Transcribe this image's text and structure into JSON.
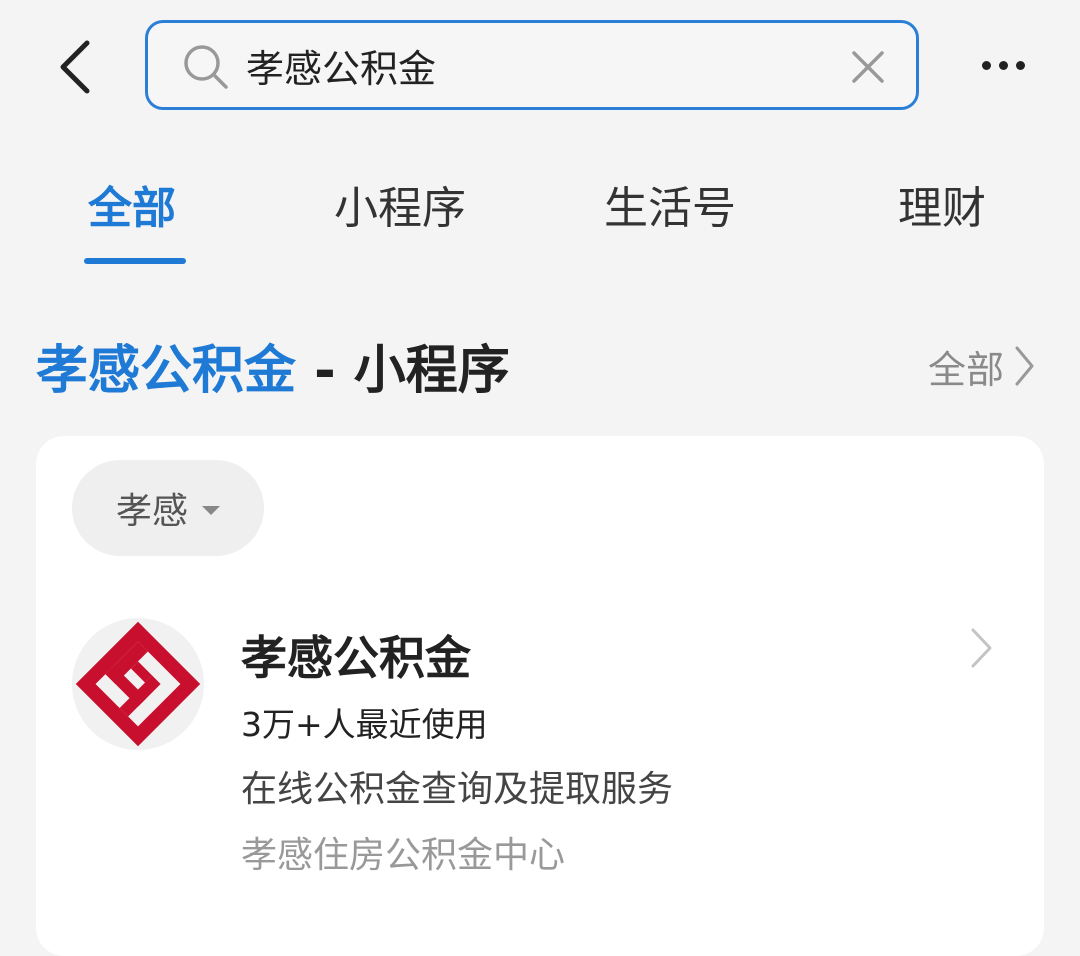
{
  "search": {
    "value": "孝感公积金"
  },
  "tabs": [
    {
      "label": "全部",
      "active": true
    },
    {
      "label": "小程序",
      "active": false
    },
    {
      "label": "生活号",
      "active": false
    },
    {
      "label": "理财",
      "active": false
    }
  ],
  "section": {
    "title_highlight": "孝感公积金",
    "title_rest": " - 小程序",
    "more_label": "全部"
  },
  "filter": {
    "label": "孝感"
  },
  "result": {
    "name": "孝感公积金",
    "usage": "3万+人最近使用",
    "description": "在线公积金查询及提取服务",
    "organization": "孝感住房公积金中心"
  },
  "colors": {
    "accent": "#1f7ad6",
    "logo_red": "#c8102e"
  },
  "icons": {
    "back": "chevron-left-icon",
    "search": "search-icon",
    "clear": "close-icon",
    "more": "more-icon",
    "section_more": "chevron-right-icon",
    "filter": "caret-down-icon",
    "row": "chevron-right-icon"
  }
}
